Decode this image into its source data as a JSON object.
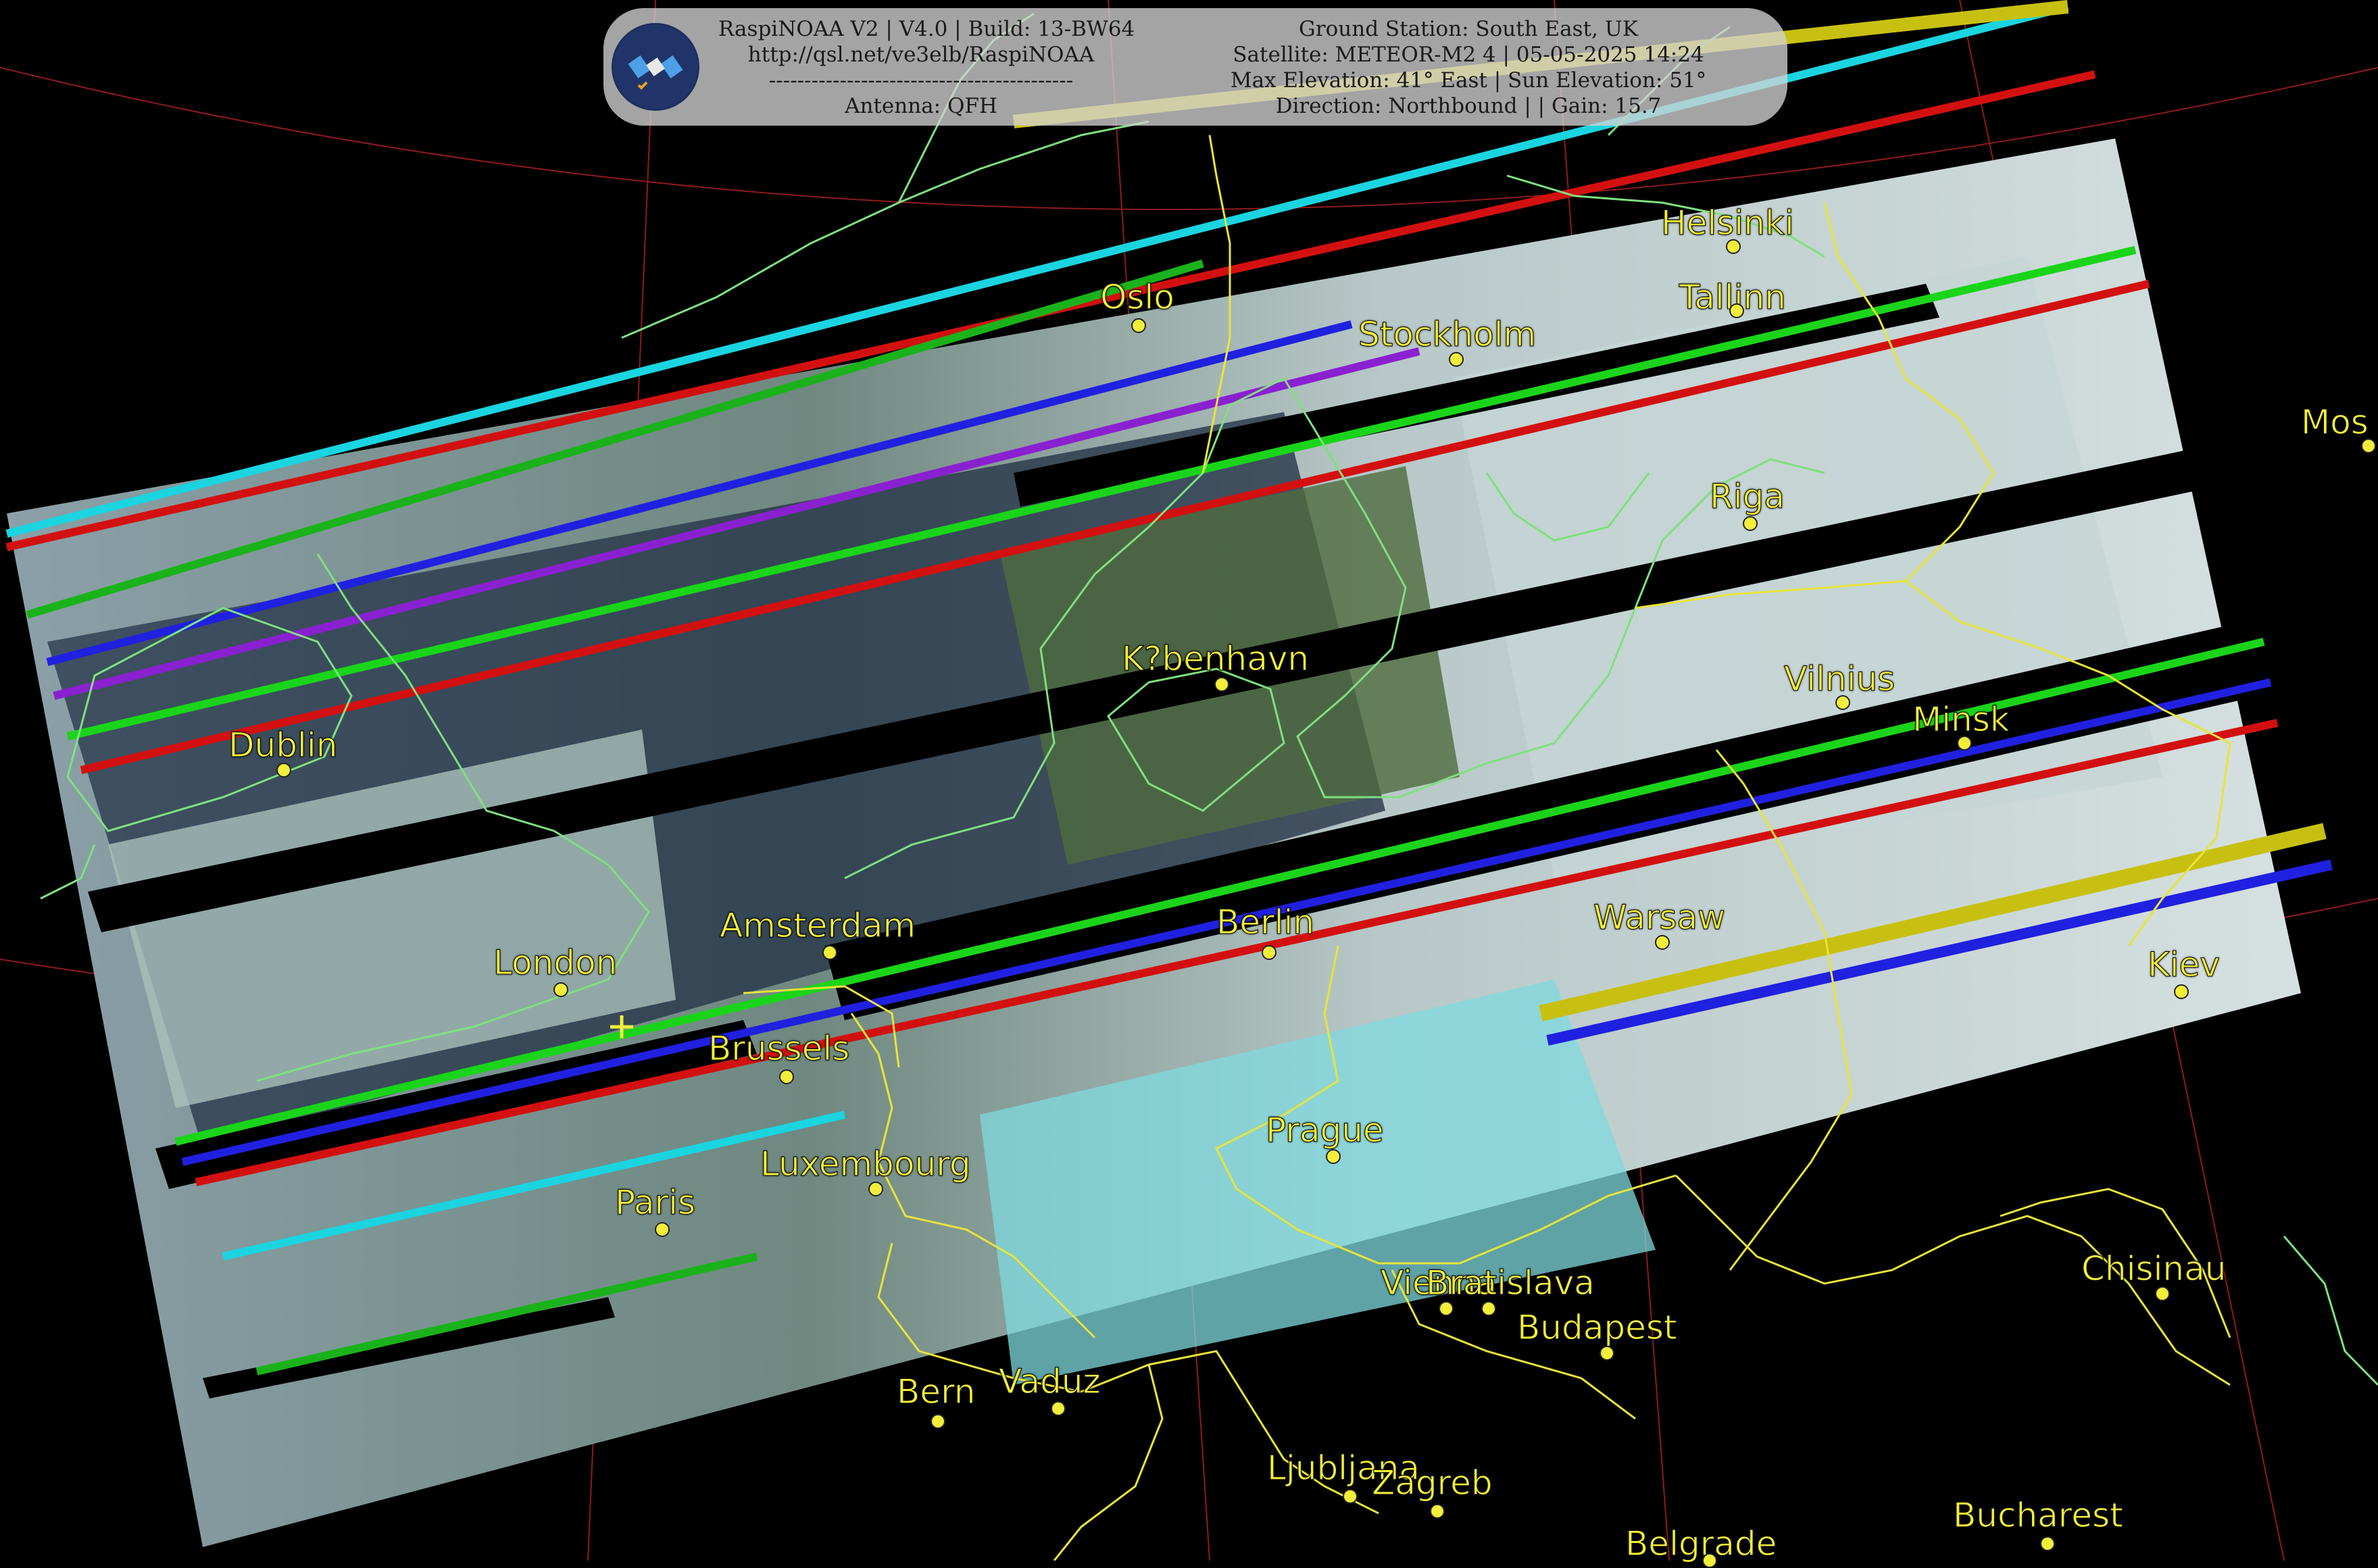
{
  "header": {
    "left_lines": [
      "RaspiNOAA V2 | V4.0 | Build: 13-BW64",
      "http://qsl.net/ve3elb/RaspiNOAA",
      "-------------------------------------------",
      "Antenna: QFH"
    ],
    "right_lines": [
      "Ground Station: South East, UK",
      "Satellite: METEOR-M2 4 | 05-05-2025 14:24",
      "Max Elevation: 41° East | Sun Elevation: 51°",
      "Direction: Northbound | | Gain: 15.7"
    ],
    "logo_icon": "satellite-icon"
  },
  "cities": [
    {
      "name": "Helsinki"
    },
    {
      "name": "Tallinn"
    },
    {
      "name": "Oslo"
    },
    {
      "name": "Stockholm"
    },
    {
      "name": "Mos"
    },
    {
      "name": "Riga"
    },
    {
      "name": "K?benhavn"
    },
    {
      "name": "Vilnius"
    },
    {
      "name": "Minsk"
    },
    {
      "name": "Dublin"
    },
    {
      "name": "Amsterdam"
    },
    {
      "name": "Berlin"
    },
    {
      "name": "Warsaw"
    },
    {
      "name": "London"
    },
    {
      "name": "Kiev"
    },
    {
      "name": "Brussels"
    },
    {
      "name": "Prague"
    },
    {
      "name": "Luxembourg"
    },
    {
      "name": "Paris"
    },
    {
      "name": "Chisinau"
    },
    {
      "name": "Vienna"
    },
    {
      "name": "Bratislava"
    },
    {
      "name": "Budapest"
    },
    {
      "name": "Bern"
    },
    {
      "name": "Vaduz"
    },
    {
      "name": "Ljubljana"
    },
    {
      "name": "Zagreb"
    },
    {
      "name": "Bucharest"
    },
    {
      "name": "Belgrade"
    }
  ],
  "colors": {
    "label": "#f3ee3a",
    "coastline": "#7fe07f",
    "border": "#f3ee3a",
    "graticule": "#b02020",
    "background": "#000000"
  }
}
